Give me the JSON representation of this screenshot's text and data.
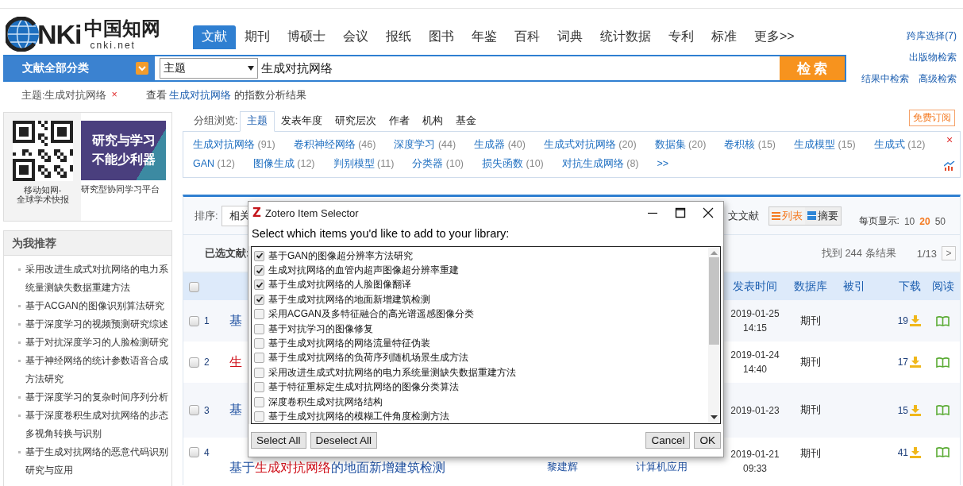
{
  "logo": {
    "mark": "NKi",
    "name": "中国知网",
    "domain": "cnki.net"
  },
  "nav": [
    {
      "label": "文献",
      "selected": true
    },
    {
      "label": "期刊",
      "selected": false
    },
    {
      "label": "博硕士",
      "selected": false
    },
    {
      "label": "会议",
      "selected": false
    },
    {
      "label": "报纸",
      "selected": false
    },
    {
      "label": "图书",
      "selected": false
    },
    {
      "label": "年鉴",
      "selected": false
    },
    {
      "label": "百科",
      "selected": false
    },
    {
      "label": "词典",
      "selected": false
    },
    {
      "label": "统计数据",
      "selected": false
    },
    {
      "label": "专利",
      "selected": false
    },
    {
      "label": "标准",
      "selected": false
    },
    {
      "label": "更多>>",
      "selected": false
    }
  ],
  "side_links": [
    "跨库选择(7)",
    "出版物检索",
    "结果中检索",
    "高级检索"
  ],
  "search": {
    "category": "文献全部分类",
    "field": "主题",
    "query": "生成对抗网络",
    "button": "检 索"
  },
  "query_tag": {
    "text": "主题:生成对抗网络",
    "remove": "×"
  },
  "index_hint": {
    "before": "查看",
    "link": "生成对抗网络",
    "after": "的指数分析结果"
  },
  "promo": {
    "qr_caption": [
      "移动知网-",
      "全球学术快报"
    ],
    "banner_lines": [
      "研究与学习",
      "不能少利器"
    ],
    "banner_caption": "研究型协同学习平台"
  },
  "recommend": {
    "title": "为我推荐",
    "items": [
      "采用改进生成式对抗网络的电力系统量测缺失数据重建方法",
      "基于ACGAN的图像识别算法研究",
      "基于深度学习的视频预测研究综述",
      "基于对抗深度学习的人脸检测研究",
      "基于神经网络的统计参数语音合成方法研究",
      "基于深度学习的复杂时间序列分析",
      "基于深度卷积生成对抗网络的步态多视角转换与识别",
      "基于生成对抗网络的恶意代码识别研究与应用"
    ]
  },
  "group_browse": {
    "label": "分组浏览:",
    "tabs": [
      {
        "label": "主题",
        "selected": true
      },
      {
        "label": "发表年度",
        "selected": false
      },
      {
        "label": "研究层次",
        "selected": false
      },
      {
        "label": "作者",
        "selected": false
      },
      {
        "label": "机构",
        "selected": false
      },
      {
        "label": "基金",
        "selected": false
      }
    ],
    "subscribe": "免费订阅"
  },
  "topics": {
    "items": [
      {
        "name": "生成对抗网络",
        "count": "(91)"
      },
      {
        "name": "卷积神经网络",
        "count": "(46)"
      },
      {
        "name": "深度学习",
        "count": "(44)"
      },
      {
        "name": "生成器",
        "count": "(40)"
      },
      {
        "name": "生成式对抗网络",
        "count": "(20)"
      },
      {
        "name": "数据集",
        "count": "(20)"
      },
      {
        "name": "卷积核",
        "count": "(15)"
      },
      {
        "name": "生成模型",
        "count": "(15)"
      },
      {
        "name": "生成式",
        "count": "(12)"
      },
      {
        "name": "GAN",
        "count": "(12)"
      },
      {
        "name": "图像生成",
        "count": "(12)"
      },
      {
        "name": "判别模型",
        "count": "(11)"
      },
      {
        "name": "分类器",
        "count": "(10)"
      },
      {
        "name": "损失函数",
        "count": "(10)"
      },
      {
        "name": "对抗生成网络",
        "count": "(8)"
      }
    ],
    "more": ">>",
    "close": "×"
  },
  "results": {
    "sort_label": "排序:",
    "sort_value": "相关",
    "language": "文文献",
    "views": [
      {
        "label": "列表",
        "selected": true
      },
      {
        "label": "摘要",
        "selected": false
      }
    ],
    "per_page_label": "每页显示:",
    "per_page": [
      {
        "label": "10",
        "selected": false
      },
      {
        "label": "20",
        "selected": true
      },
      {
        "label": "50",
        "selected": false
      }
    ],
    "selected_label": "已选文献:",
    "found": "找到 244 条结果",
    "page": "1/13",
    "next": ">",
    "all_checked": false,
    "columns": [
      "发表时间",
      "数据库",
      "被引",
      "下载",
      "阅读"
    ],
    "rows": [
      {
        "checked": false,
        "number": "1",
        "title": [
          {
            "text": "基",
            "highlight": false
          }
        ],
        "date": "2019-01-25",
        "time": "14:15",
        "database": "期刊",
        "downloads": "19"
      },
      {
        "checked": false,
        "number": "2",
        "title": [
          {
            "text": "生",
            "highlight": true
          }
        ],
        "date": "2019-01-24",
        "time": "14:40",
        "database": "期刊",
        "downloads": "17"
      },
      {
        "checked": false,
        "number": "3",
        "title": [
          {
            "text": "基",
            "highlight": false
          }
        ],
        "date": "2019-01-23",
        "database": "期刊",
        "downloads": "15"
      },
      {
        "checked": false,
        "number": "4",
        "title": [
          {
            "text": "基于",
            "highlight": false
          },
          {
            "text": "生成对抗网络",
            "highlight": true
          },
          {
            "text": "的地面新增建筑检测",
            "highlight": false
          }
        ],
        "author": "黎建辉",
        "source": "计算机应用",
        "date": "2019-01-21",
        "time": "09:33",
        "database": "期刊",
        "downloads": "41"
      }
    ]
  },
  "dialog": {
    "icon_letter": "Z",
    "title": "Zotero Item Selector",
    "prompt": "Select which items you'd like to add to your library:",
    "items": [
      {
        "label": "基于GAN的图像超分辨率方法研究",
        "checked": true
      },
      {
        "label": "生成对抗网络的血管内超声图像超分辨率重建",
        "checked": true
      },
      {
        "label": "基于生成对抗网络的人脸图像翻译",
        "checked": true
      },
      {
        "label": "基于生成对抗网络的地面新增建筑检测",
        "checked": true
      },
      {
        "label": "采用ACGAN及多特征融合的高光谱遥感图像分类",
        "checked": false
      },
      {
        "label": "基于对抗学习的图像修复",
        "checked": false
      },
      {
        "label": "基于生成对抗网络的网络流量特征伪装",
        "checked": false
      },
      {
        "label": "基于生成对抗网络的负荷序列随机场景生成方法",
        "checked": false
      },
      {
        "label": "采用改进生成式对抗网络的电力系统量测缺失数据重建方法",
        "checked": false
      },
      {
        "label": "基于特征重标定生成对抗网络的图像分类算法",
        "checked": false
      },
      {
        "label": "深度卷积生成对抗网络结构",
        "checked": false
      },
      {
        "label": "基于生成对抗网络的模糊工件角度检测方法",
        "checked": false
      }
    ],
    "left_buttons": [
      "Select All",
      "Deselect All"
    ],
    "right_buttons": [
      "Cancel",
      "OK"
    ]
  }
}
